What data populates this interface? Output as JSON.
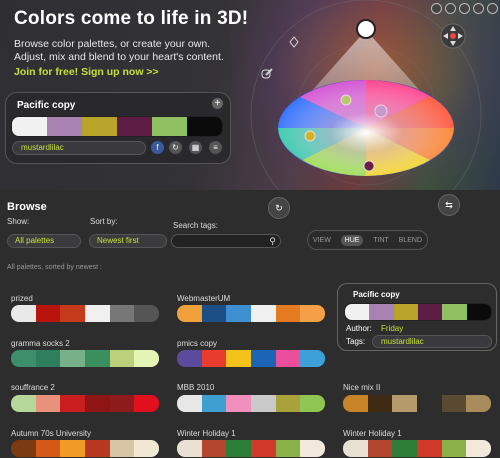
{
  "hero": {
    "title": "Colors come to life in 3D!",
    "line1": "Browse color palettes, or create your own.",
    "line2": "Adjust, mix and blend to your heart's content.",
    "cta": "Join for free! Sign up now >>"
  },
  "current_palette": {
    "title": "Pacific copy",
    "add_icon": "plus-icon",
    "colors": [
      "#f1f1f1",
      "#a882b3",
      "#b8a42b",
      "#5d1d44",
      "#8fc062",
      "#0b0b0b"
    ],
    "tags": "mustardlilac",
    "buttons": [
      "facebook-icon",
      "share-icon",
      "grid-icon",
      "menu-icon"
    ]
  },
  "browse": {
    "title": "Browse",
    "show_label": "Show:",
    "show_value": "All palettes",
    "sort_label": "Sort by:",
    "sort_value": "Newest first",
    "search_label": "Search tags:",
    "search_placeholder": "",
    "modes": [
      "VIEW",
      "HUE",
      "TINT",
      "BLEND"
    ],
    "active_mode": "HUE",
    "sort_note": "All palettes, sorted by newest :"
  },
  "palettes": [
    {
      "name": "prized",
      "colors": [
        "#e9e9e9",
        "#b7140d",
        "#c53a1a",
        "#f0f0f0",
        "#777777",
        "#555555"
      ]
    },
    {
      "name": "WebmasterUM",
      "colors": [
        "#f0a13b",
        "#1c4f86",
        "#3c8fd1",
        "#f0f0f0",
        "#e47b23",
        "#f3a046"
      ]
    },
    {
      "name": "gramma socks 2",
      "colors": [
        "#3d8e6a",
        "#2f7f5e",
        "#78b08a",
        "#3b8e5d",
        "#bcd07b",
        "#e4f4b4"
      ]
    },
    {
      "name": "pmics copy",
      "colors": [
        "#5b4b9d",
        "#e83c2c",
        "#f3c21b",
        "#1b65b4",
        "#ea4f9b",
        "#3da0d8"
      ]
    },
    {
      "name": "souffrance 2",
      "colors": [
        "#b5d79a",
        "#e8917d",
        "#c91d1f",
        "#8f1515",
        "#8e1b1b",
        "#e0101c"
      ]
    },
    {
      "name": "MBB 2010",
      "colors": [
        "#e7e7e7",
        "#3f9fd0",
        "#f08fbc",
        "#c9c9c9",
        "#a9a23a",
        "#8fc552"
      ]
    },
    {
      "name": "Nice mix II",
      "colors": [
        "#c88227",
        "#3e2a12",
        "#b59a6c",
        "#2d2d2d",
        "#5a4a32",
        "#a88c5c"
      ]
    },
    {
      "name": "Autumn 70s University",
      "colors": [
        "#7b3a11",
        "#d25a16",
        "#f09a28",
        "#b8381f",
        "#d7c6a6",
        "#f1e8d4"
      ]
    },
    {
      "name": "Winter Holiday 1",
      "colors": [
        "#e8e0d0",
        "#b4452e",
        "#2e7d36",
        "#d13a2a",
        "#8ab04a",
        "#f2e9dc"
      ]
    },
    {
      "name": "Winter Holiday 1",
      "colors": [
        "#e8e0d0",
        "#b4452e",
        "#2e7d36",
        "#d13a2a",
        "#8ab04a",
        "#f2e9dc"
      ]
    }
  ],
  "popup": {
    "title": "Pacific copy",
    "colors": [
      "#f1f1f1",
      "#a882b3",
      "#b8a42b",
      "#5d1d44",
      "#8fc062",
      "#0b0b0b"
    ],
    "author_label": "Author:",
    "author_value": "Friday",
    "tags_label": "Tags:",
    "tags_value": "mustardlilac"
  },
  "colors": {
    "accent": "#c6e13a",
    "background": "#2d2d2d"
  }
}
